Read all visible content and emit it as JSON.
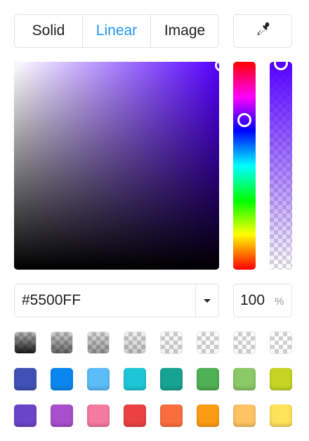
{
  "tabs": [
    {
      "label": "Solid",
      "active": false
    },
    {
      "label": "Linear",
      "active": true
    },
    {
      "label": "Image",
      "active": false
    }
  ],
  "eyedropper": {
    "icon": "eyedropper-icon"
  },
  "picker": {
    "hue_color": "#5500FF",
    "hue_level": 0.72,
    "alpha_level": 1.0
  },
  "hex": {
    "value": "#5500FF"
  },
  "opacity": {
    "value": "100",
    "unit": "%"
  },
  "swatch_rows": [
    [
      {
        "color": "#000000",
        "opacity": 0.9
      },
      {
        "color": "#000000",
        "opacity": 0.6
      },
      {
        "color": "#000000",
        "opacity": 0.4
      },
      {
        "color": "#000000",
        "opacity": 0.2
      },
      {
        "color": "#000000",
        "opacity": 0.06
      },
      {
        "color": "#000000",
        "opacity": 0.03
      },
      {
        "color": "#000000",
        "opacity": 0.02
      },
      {
        "color": "#000000",
        "opacity": 0.0
      }
    ],
    [
      {
        "color": "#3f51b5"
      },
      {
        "color": "#0b86ee"
      },
      {
        "color": "#5bbcf8"
      },
      {
        "color": "#1cc6d6"
      },
      {
        "color": "#16a392"
      },
      {
        "color": "#4fb055"
      },
      {
        "color": "#8bc866"
      },
      {
        "color": "#c4d623"
      }
    ],
    [
      {
        "color": "#6a45c9"
      },
      {
        "color": "#a84fcd"
      },
      {
        "color": "#f47aa0"
      },
      {
        "color": "#ea4244"
      },
      {
        "color": "#fa6e3e"
      },
      {
        "color": "#fb9d12"
      },
      {
        "color": "#fdc364"
      },
      {
        "color": "#fde25a"
      }
    ]
  ]
}
